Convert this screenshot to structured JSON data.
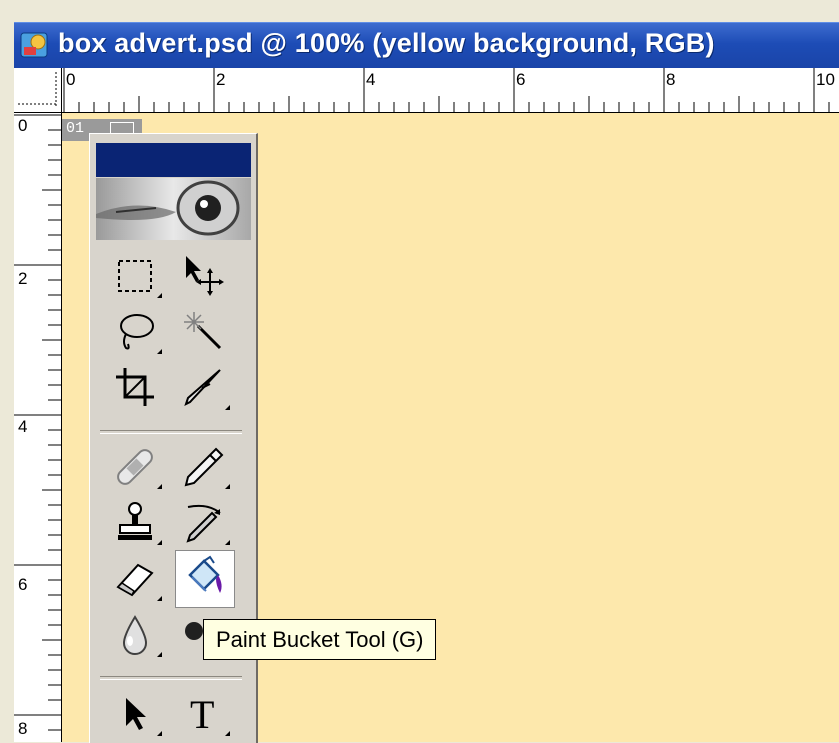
{
  "window": {
    "title": "box advert.psd @ 100% (yellow background, RGB)"
  },
  "rulers": {
    "top_labels": [
      "0",
      "2",
      "4",
      "6",
      "8",
      "10"
    ],
    "left_labels": [
      "0",
      "2",
      "4",
      "6",
      "8"
    ]
  },
  "canvas": {
    "background_color": "#fde8ac",
    "slice_number": "01"
  },
  "tools_palette": {
    "title_color": "#0a2474",
    "tools": [
      {
        "name": "rectangular-marquee-tool",
        "icon": "marquee-icon"
      },
      {
        "name": "move-tool",
        "icon": "move-icon"
      },
      {
        "name": "lasso-tool",
        "icon": "lasso-icon"
      },
      {
        "name": "magic-wand-tool",
        "icon": "magic-wand-icon"
      },
      {
        "name": "crop-tool",
        "icon": "crop-icon"
      },
      {
        "name": "slice-tool",
        "icon": "slice-knife-icon"
      },
      {
        "name": "healing-brush-tool",
        "icon": "bandage-icon"
      },
      {
        "name": "brush-tool",
        "icon": "pencil-icon"
      },
      {
        "name": "clone-stamp-tool",
        "icon": "stamp-icon"
      },
      {
        "name": "history-brush-tool",
        "icon": "history-brush-icon"
      },
      {
        "name": "eraser-tool",
        "icon": "eraser-icon"
      },
      {
        "name": "paint-bucket-tool",
        "icon": "paint-bucket-icon",
        "selected": true
      },
      {
        "name": "blur-tool",
        "icon": "drop-icon"
      },
      {
        "name": "dodge-tool",
        "icon": "dodge-icon"
      },
      {
        "name": "path-selection-tool",
        "icon": "arrow-icon"
      },
      {
        "name": "type-tool",
        "icon": "type-icon"
      }
    ],
    "type_tool_glyph": "T"
  },
  "tooltip": {
    "text": "Paint Bucket Tool (G)"
  }
}
